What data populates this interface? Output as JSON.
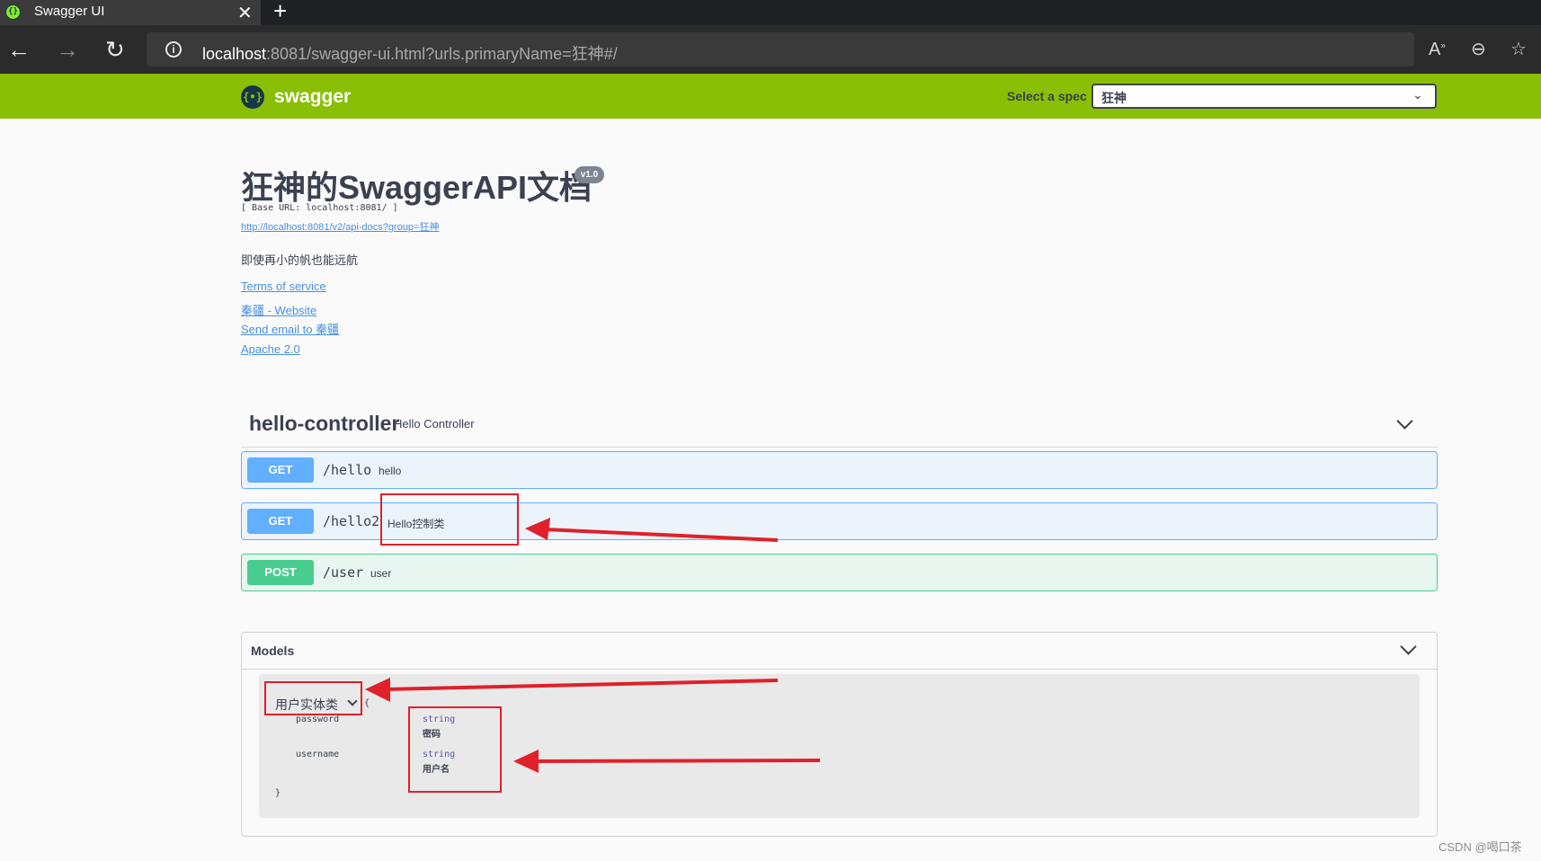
{
  "browser": {
    "tab_title": "Swagger UI",
    "tab_close": "✕",
    "new_tab": "+",
    "url_host": "localhost",
    "url_rest": ":8081/swagger-ui.html?urls.primaryName=狂神#/"
  },
  "topbar": {
    "logo_text": "swagger",
    "logo_glyph": "{•}",
    "spec_label": "Select a spec",
    "spec_value": "狂神"
  },
  "info": {
    "title": "狂神的SwaggerAPI文档",
    "version": "v1.0",
    "base_url": "[ Base URL: localhost:8081/ ]",
    "api_docs_link": "http://localhost:8081/v2/api-docs?group=狂神",
    "description": "即使再小的帆也能远航",
    "terms": "Terms of service",
    "website": "秦疆 - Website",
    "email": "Send email to 秦疆",
    "license": "Apache 2.0"
  },
  "tag": {
    "name": "hello-controller",
    "description": "Hello Controller",
    "operations": [
      {
        "method": "GET",
        "path": "/hello",
        "summary": "hello"
      },
      {
        "method": "GET",
        "path": "/hello2",
        "summary": "Hello控制类"
      },
      {
        "method": "POST",
        "path": "/user",
        "summary": "user"
      }
    ]
  },
  "models": {
    "title": "Models",
    "model_name": "用户实体类",
    "open_brace": "{",
    "close_brace": "}",
    "properties": [
      {
        "name": "password",
        "type": "string",
        "description": "密码"
      },
      {
        "name": "username",
        "type": "string",
        "description": "用户名"
      }
    ]
  },
  "watermark": "CSDN @喝口茶",
  "colors": {
    "topbar": "#89bf04",
    "get": "#61affe",
    "post": "#49cc90",
    "annotation_red": "#e0202a"
  }
}
